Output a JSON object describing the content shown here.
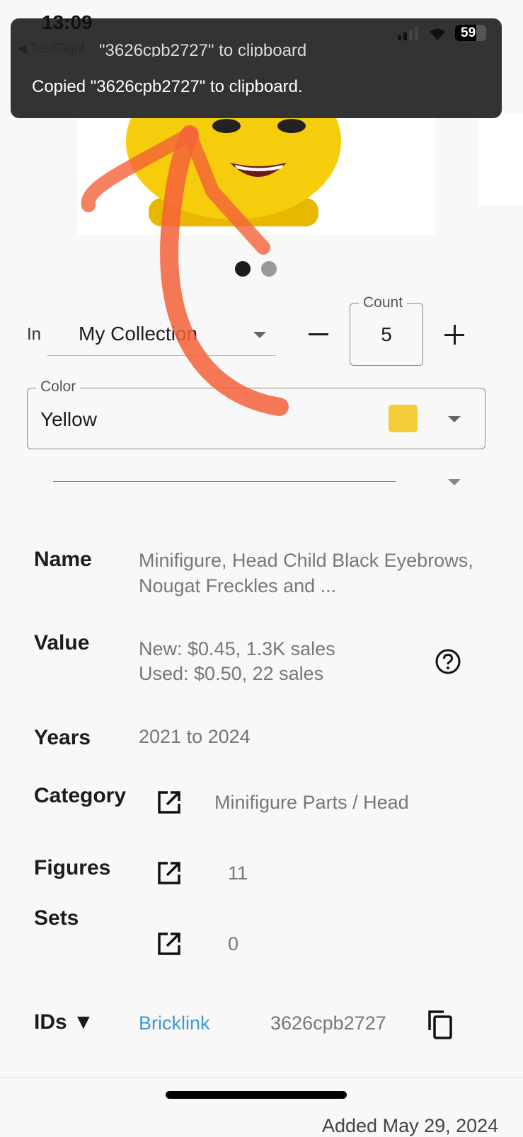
{
  "status_bar": {
    "time": "13:09",
    "back_label": "TestFlight",
    "battery": "59"
  },
  "toast": {
    "message": "Copied \"3626cpb2727\" to clipboard.",
    "ghost": "\"3626cpb2727\" to clipboard"
  },
  "carousel": {
    "pages": 2,
    "active": 0
  },
  "collection": {
    "prefix": "In",
    "selected": "My Collection",
    "count_label": "Count",
    "count": "5"
  },
  "color": {
    "label": "Color",
    "selected": "Yellow",
    "swatch": "#F2CD37"
  },
  "details": {
    "name": {
      "label": "Name",
      "value": "Minifigure, Head Child Black Eyebrows, Nougat Freckles and ..."
    },
    "value": {
      "label": "Value",
      "new": "New: $0.45, 1.3K sales",
      "used": "Used: $0.50, 22 sales"
    },
    "years": {
      "label": "Years",
      "value": "2021 to 2024"
    },
    "category": {
      "label": "Category",
      "value": "Minifigure Parts / Head"
    },
    "figures": {
      "label": "Figures",
      "value": "11"
    },
    "sets": {
      "label": "Sets",
      "value": "0"
    },
    "ids": {
      "label": "IDs ▼",
      "source": "Bricklink",
      "id": "3626cpb2727"
    }
  },
  "footer": {
    "added": "Added May 29, 2024"
  },
  "colors": {
    "link": "#3A99D8",
    "toast_bg": "#333333",
    "annotation": "#F4623A"
  }
}
